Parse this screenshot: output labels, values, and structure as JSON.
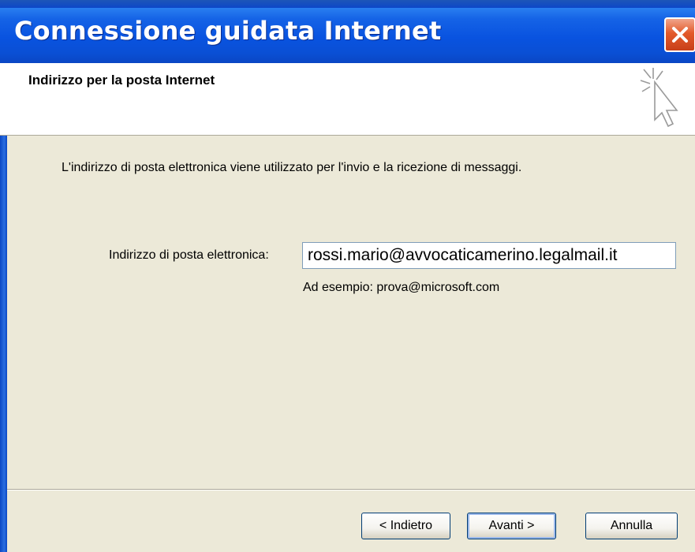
{
  "window": {
    "title": "Connessione guidata Internet",
    "close_icon": "close-icon"
  },
  "header": {
    "title": "Indirizzo per la posta Internet",
    "icon": "wizard-cursor-icon"
  },
  "content": {
    "description": "L'indirizzo di posta elettronica viene utilizzato per l'invio e la ricezione di messaggi.",
    "email_label": "Indirizzo di posta elettronica:",
    "email_value": "rossi.mario@avvocaticamerino.legalmail.it",
    "example": "Ad esempio: prova@microsoft.com"
  },
  "buttons": {
    "back": "< Indietro",
    "next": "Avanti >",
    "cancel": "Annulla"
  },
  "colors": {
    "titlebar": "#0a53e0",
    "body": "#ece9d8",
    "close": "#e35a2a"
  }
}
